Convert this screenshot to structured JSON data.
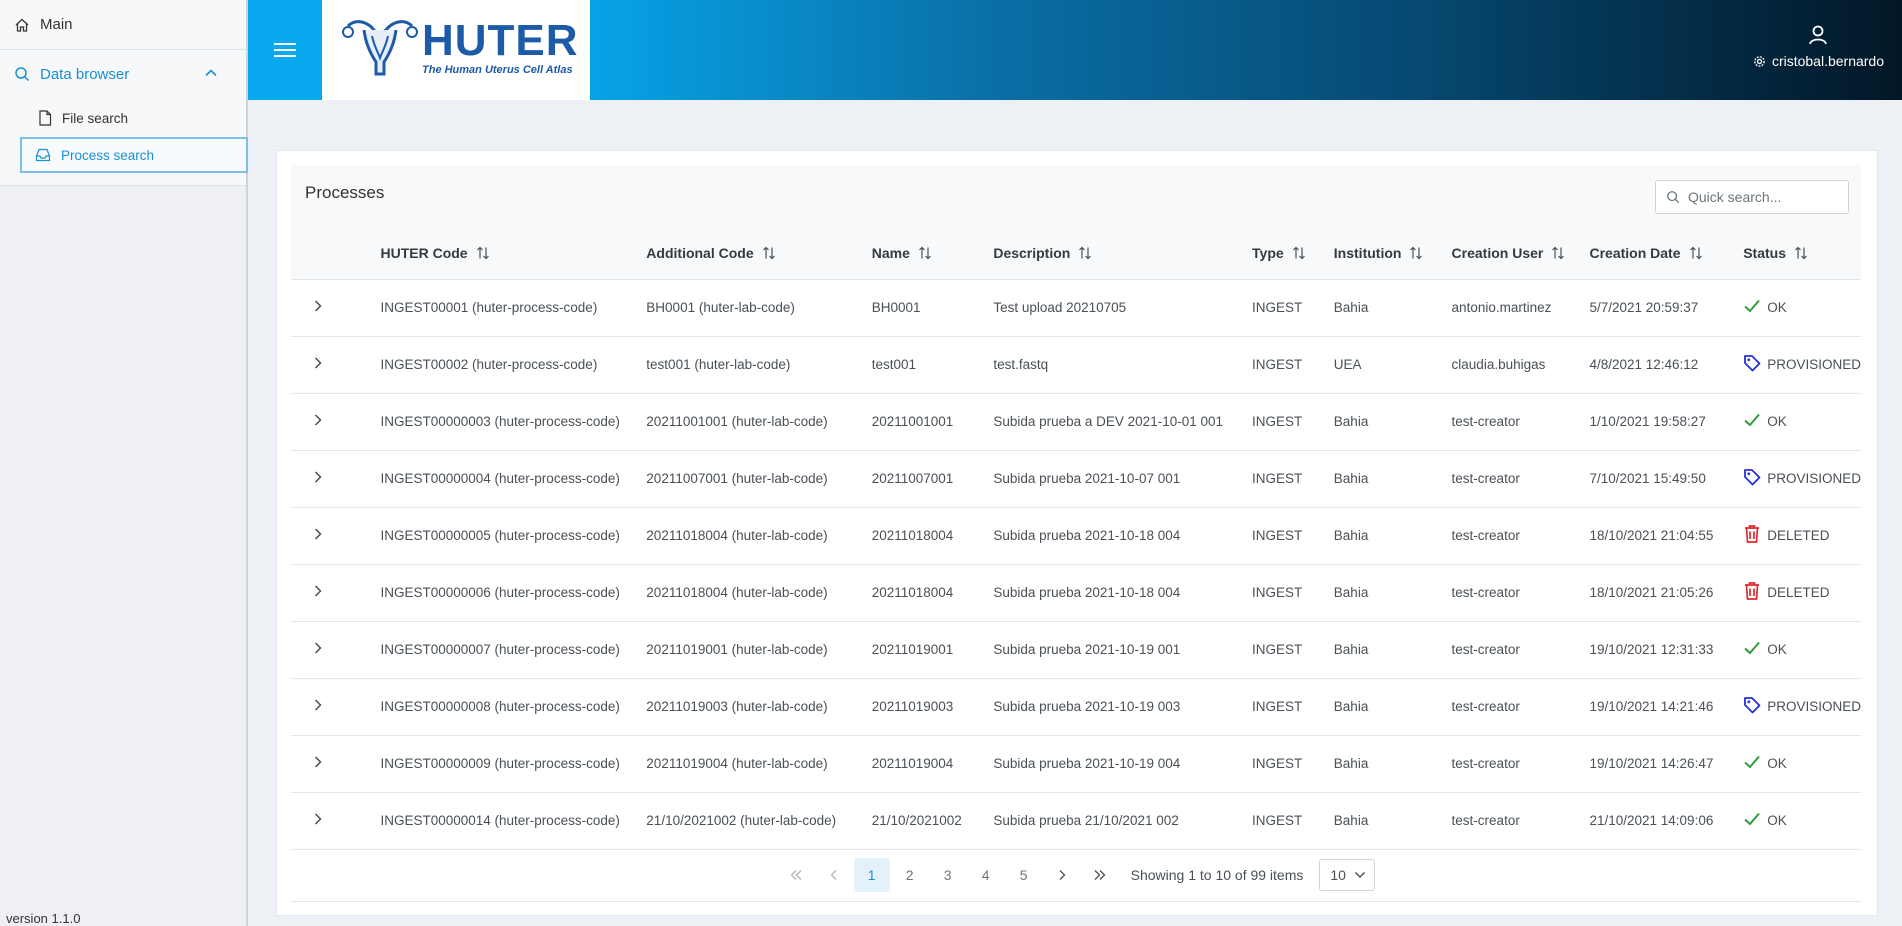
{
  "sidebar": {
    "main_label": "Main",
    "data_browser_label": "Data browser",
    "file_search_label": "File search",
    "process_search_label": "Process search",
    "version": "version 1.1.0"
  },
  "header": {
    "logo_title": "HUTER",
    "logo_subtitle": "The Human Uterus Cell Atlas",
    "username": "cristobal.bernardo"
  },
  "processes": {
    "title": "Processes",
    "search_placeholder": "Quick search...",
    "columns": [
      "HUTER Code",
      "Additional Code",
      "Name",
      "Description",
      "Type",
      "Institution",
      "Creation User",
      "Creation Date",
      "Status"
    ],
    "rows": [
      {
        "huter_code": "INGEST00001 (huter-process-code)",
        "additional_code": "BH0001 (huter-lab-code)",
        "name": "BH0001",
        "description": "Test upload 20210705",
        "type": "INGEST",
        "institution": "Bahia",
        "user": "antonio.martinez",
        "date": "5/7/2021 20:59:37",
        "status": "OK",
        "status_icon": "check-icon"
      },
      {
        "huter_code": "INGEST00002 (huter-process-code)",
        "additional_code": "test001 (huter-lab-code)",
        "name": "test001",
        "description": "test.fastq",
        "type": "INGEST",
        "institution": "UEA",
        "user": "claudia.buhigas",
        "date": "4/8/2021 12:46:12",
        "status": "PROVISIONED",
        "status_icon": "tag-icon"
      },
      {
        "huter_code": "INGEST00000003 (huter-process-code)",
        "additional_code": "20211001001 (huter-lab-code)",
        "name": "20211001001",
        "description": "Subida prueba a DEV 2021-10-01 001",
        "type": "INGEST",
        "institution": "Bahia",
        "user": "test-creator",
        "date": "1/10/2021 19:58:27",
        "status": "OK",
        "status_icon": "check-icon"
      },
      {
        "huter_code": "INGEST00000004 (huter-process-code)",
        "additional_code": "20211007001 (huter-lab-code)",
        "name": "20211007001",
        "description": "Subida prueba 2021-10-07 001",
        "type": "INGEST",
        "institution": "Bahia",
        "user": "test-creator",
        "date": "7/10/2021 15:49:50",
        "status": "PROVISIONED",
        "status_icon": "tag-icon"
      },
      {
        "huter_code": "INGEST00000005 (huter-process-code)",
        "additional_code": "20211018004 (huter-lab-code)",
        "name": "20211018004",
        "description": "Subida prueba 2021-10-18 004",
        "type": "INGEST",
        "institution": "Bahia",
        "user": "test-creator",
        "date": "18/10/2021 21:04:55",
        "status": "DELETED",
        "status_icon": "trash-icon"
      },
      {
        "huter_code": "INGEST00000006 (huter-process-code)",
        "additional_code": "20211018004 (huter-lab-code)",
        "name": "20211018004",
        "description": "Subida prueba 2021-10-18 004",
        "type": "INGEST",
        "institution": "Bahia",
        "user": "test-creator",
        "date": "18/10/2021 21:05:26",
        "status": "DELETED",
        "status_icon": "trash-icon"
      },
      {
        "huter_code": "INGEST00000007 (huter-process-code)",
        "additional_code": "20211019001 (huter-lab-code)",
        "name": "20211019001",
        "description": "Subida prueba 2021-10-19 001",
        "type": "INGEST",
        "institution": "Bahia",
        "user": "test-creator",
        "date": "19/10/2021 12:31:33",
        "status": "OK",
        "status_icon": "check-icon"
      },
      {
        "huter_code": "INGEST00000008 (huter-process-code)",
        "additional_code": "20211019003 (huter-lab-code)",
        "name": "20211019003",
        "description": "Subida prueba 2021-10-19 003",
        "type": "INGEST",
        "institution": "Bahia",
        "user": "test-creator",
        "date": "19/10/2021 14:21:46",
        "status": "PROVISIONED",
        "status_icon": "tag-icon"
      },
      {
        "huter_code": "INGEST00000009 (huter-process-code)",
        "additional_code": "20211019004 (huter-lab-code)",
        "name": "20211019004",
        "description": "Subida prueba 2021-10-19 004",
        "type": "INGEST",
        "institution": "Bahia",
        "user": "test-creator",
        "date": "19/10/2021 14:26:47",
        "status": "OK",
        "status_icon": "check-icon"
      },
      {
        "huter_code": "INGEST00000014 (huter-process-code)",
        "additional_code": "21/10/2021002 (huter-lab-code)",
        "name": "21/10/2021002",
        "description": "Subida prueba 21/10/2021 002",
        "type": "INGEST",
        "institution": "Bahia",
        "user": "test-creator",
        "date": "21/10/2021 14:09:06",
        "status": "OK",
        "status_icon": "check-icon"
      }
    ]
  },
  "paginator": {
    "pages": [
      "1",
      "2",
      "3",
      "4",
      "5"
    ],
    "current_page": "1",
    "info": "Showing 1 to 10 of 99 items",
    "rows_per_page": "10"
  },
  "colors": {
    "accent": "#1a8fd1",
    "header_start": "#07a8ee",
    "header_end": "#021726",
    "status_ok": "#2e9c3a",
    "status_provisioned": "#2431d6",
    "status_deleted": "#e0292e"
  }
}
